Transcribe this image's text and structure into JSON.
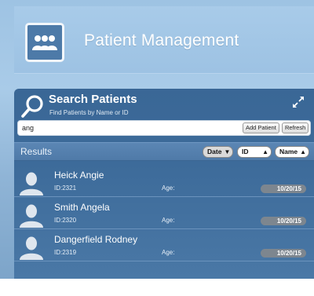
{
  "header": {
    "title": "Patient Management",
    "logo_icon": "group-users-icon"
  },
  "search": {
    "title": "Search Patients",
    "subtitle": "Find Patients by Name or ID",
    "query": "ang",
    "add_patient_label": "Add Patient",
    "refresh_label": "Refresh",
    "expand_icon": "expand-arrows-icon"
  },
  "results": {
    "label": "Results",
    "sort": {
      "date_label": "Date",
      "id_label": "ID",
      "name_label": "Name"
    },
    "rows": [
      {
        "name": "Heick Angie",
        "id": "ID:2321",
        "age_label": "Age:",
        "date": "10/20/15"
      },
      {
        "name": "Smith Angela",
        "id": "ID:2320",
        "age_label": "Age:",
        "date": "10/20/15"
      },
      {
        "name": "Dangerfield Rodney",
        "id": "ID:2319",
        "age_label": "Age:",
        "date": "10/20/15"
      }
    ]
  },
  "colors": {
    "panel": "#3d6b9a",
    "header": "#9dc2e3",
    "badge": "#7d868f"
  }
}
